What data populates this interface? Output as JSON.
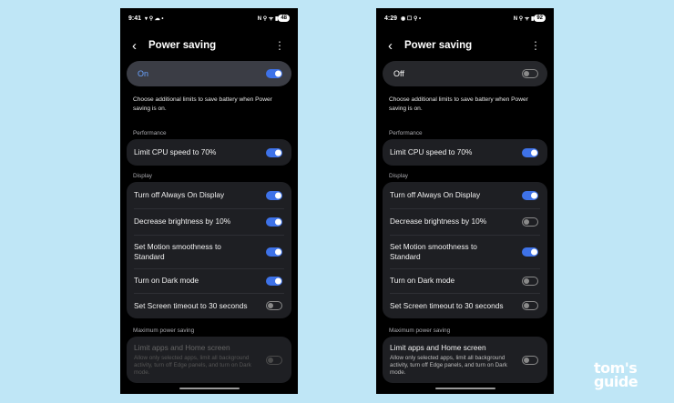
{
  "screens": [
    {
      "status": {
        "time": "9:41",
        "left_icons": "▾ ⚲ ☁ •",
        "right_icons": "N ⚲ ᯤ ▮",
        "battery": "48"
      },
      "title": "Power saving",
      "master": {
        "label": "On",
        "state": "on"
      },
      "description": "Choose additional limits to save battery when Power saving is on.",
      "performance": {
        "section": "Performance",
        "rows": [
          {
            "label": "Limit CPU speed to 70%",
            "state": "on"
          }
        ]
      },
      "display": {
        "section": "Display",
        "rows": [
          {
            "label": "Turn off Always On Display",
            "state": "on"
          },
          {
            "label": "Decrease brightness by 10%",
            "state": "on"
          },
          {
            "label": "Set Motion smoothness to Standard",
            "state": "on"
          },
          {
            "label": "Turn on Dark mode",
            "state": "on"
          },
          {
            "label": "Set Screen timeout to 30 seconds",
            "state": "off"
          }
        ]
      },
      "maximum": {
        "section": "Maximum power saving",
        "row": {
          "label": "Limit apps and Home screen",
          "sub": "Allow only selected apps, limit all background activity, turn off Edge panels, and turn on Dark mode.",
          "state": "off",
          "disabled": true
        }
      }
    },
    {
      "status": {
        "time": "4:29",
        "left_icons": "◉ ☐ ⚲ •",
        "right_icons": "N ⚲ ᯤ ▮",
        "battery": "92"
      },
      "title": "Power saving",
      "master": {
        "label": "Off",
        "state": "off"
      },
      "description": "Choose additional limits to save battery when Power saving is on.",
      "performance": {
        "section": "Performance",
        "rows": [
          {
            "label": "Limit CPU speed to 70%",
            "state": "on"
          }
        ]
      },
      "display": {
        "section": "Display",
        "rows": [
          {
            "label": "Turn off Always On Display",
            "state": "on"
          },
          {
            "label": "Decrease brightness by 10%",
            "state": "off"
          },
          {
            "label": "Set Motion smoothness to Standard",
            "state": "on"
          },
          {
            "label": "Turn on Dark mode",
            "state": "off"
          },
          {
            "label": "Set Screen timeout to 30 seconds",
            "state": "off"
          }
        ]
      },
      "maximum": {
        "section": "Maximum power saving",
        "row": {
          "label": "Limit apps and Home screen",
          "sub": "Allow only selected apps, limit all background activity, turn off Edge panels, and turn on Dark mode.",
          "state": "off",
          "disabled": false
        }
      }
    }
  ],
  "icons": {
    "back": "chevron-left-icon",
    "more": "more-vertical-icon"
  },
  "colors": {
    "background": "#bfe6f6",
    "accent": "#3e72e8",
    "master_on_text": "#6aa3ff"
  },
  "watermark": {
    "line1": "tom's",
    "line2": "guide"
  }
}
